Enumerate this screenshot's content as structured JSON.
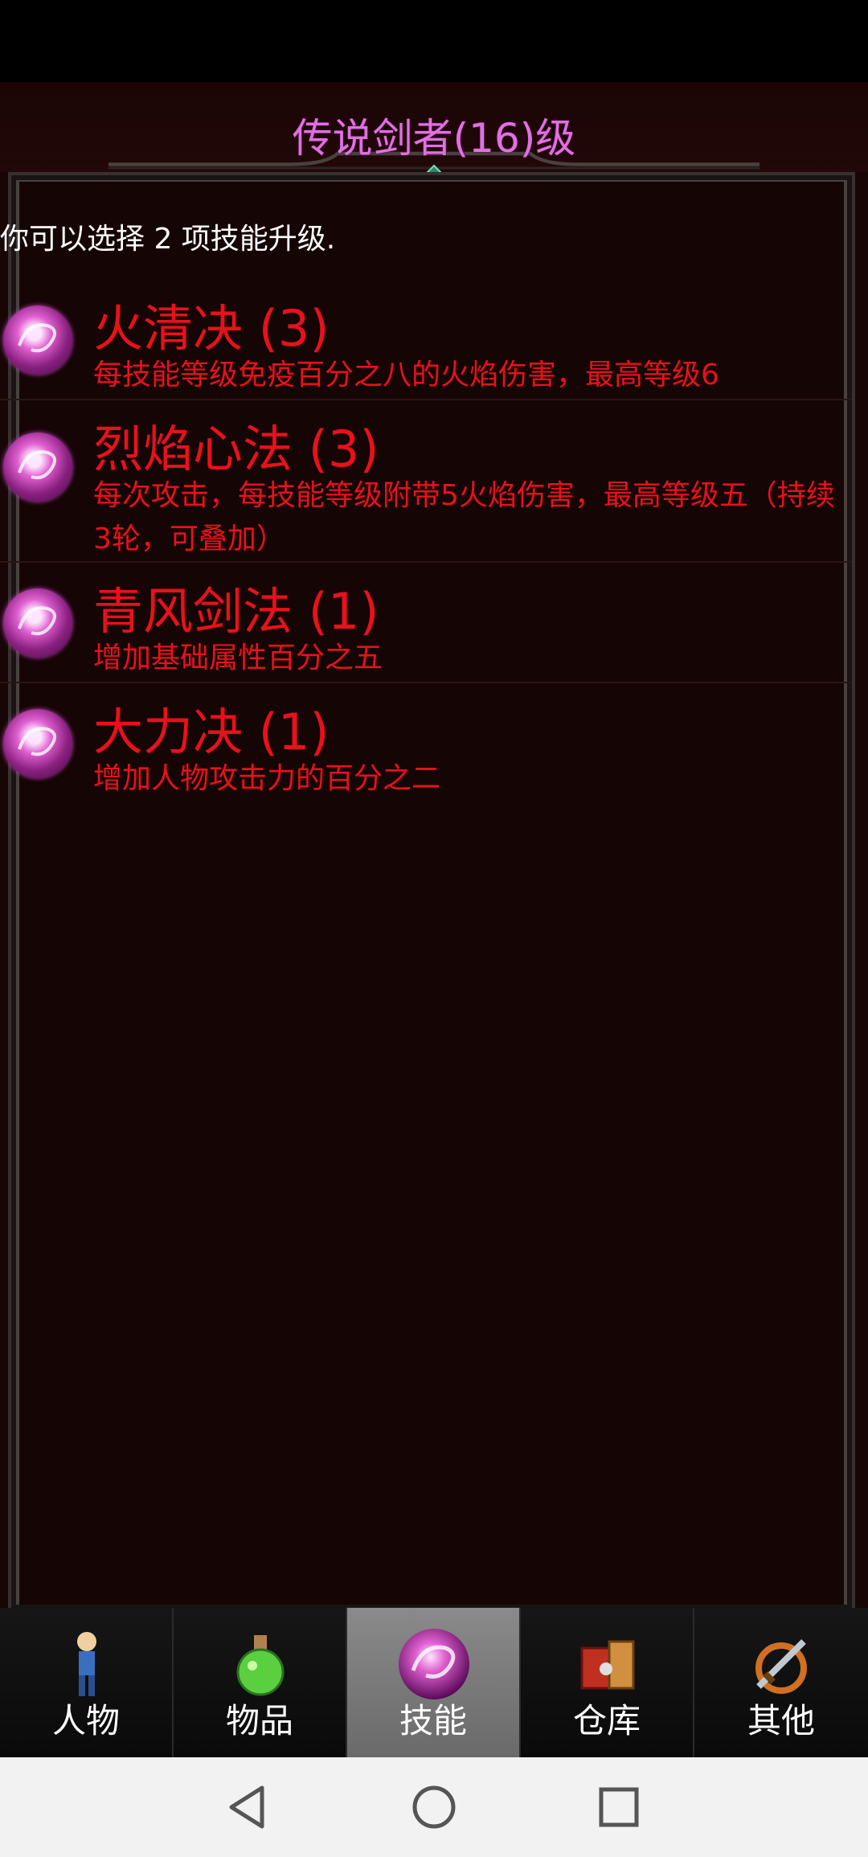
{
  "header": {
    "title": "传说剑者(16)级"
  },
  "prompt": "你可以选择 2 项技能升级.",
  "skills": [
    {
      "name": "火清决 (3)",
      "desc": "每技能等级免疫百分之八的火焰伤害，最高等级6"
    },
    {
      "name": "烈焰心法 (3)",
      "desc": "每次攻击，每技能等级附带5火焰伤害，最高等级五（持续3轮，可叠加）"
    },
    {
      "name": "青风剑法 (1)",
      "desc": "增加基础属性百分之五"
    },
    {
      "name": "大力决 (1)",
      "desc": "增加人物攻击力的百分之二"
    }
  ],
  "tabs": [
    {
      "label": "人物",
      "icon": "character-icon",
      "active": false
    },
    {
      "label": "物品",
      "icon": "potion-icon",
      "active": false
    },
    {
      "label": "技能",
      "icon": "skill-orb-icon",
      "active": true
    },
    {
      "label": "仓库",
      "icon": "storage-icon",
      "active": false
    },
    {
      "label": "其他",
      "icon": "sword-icon",
      "active": false
    }
  ],
  "navbar": {
    "back": "back-icon",
    "home": "home-icon",
    "recents": "recents-icon"
  },
  "colors": {
    "title": "#e070e0",
    "skill_text": "#e8111a",
    "background": "#160505"
  }
}
